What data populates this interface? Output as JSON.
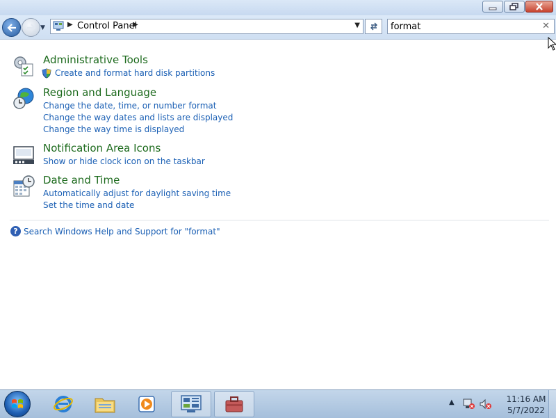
{
  "window": {
    "buttons": {
      "minimize": "minimize",
      "restore": "restore",
      "close": "close"
    }
  },
  "address": {
    "breadcrumb": "Control Panel",
    "dropdown_icon": "chevron-down-icon",
    "refresh_icon": "refresh-icon"
  },
  "search": {
    "value": "format",
    "clear_icon": "clear-icon"
  },
  "results": [
    {
      "title": "Administrative Tools",
      "icon": "administrative-tools-icon",
      "links": [
        "Create and format hard disk partitions"
      ]
    },
    {
      "title": "Region and Language",
      "icon": "globe-clock-icon",
      "links": [
        "Change the date, time, or number format",
        "Change the way dates and lists are displayed",
        "Change the way time is displayed"
      ]
    },
    {
      "title": "Notification Area Icons",
      "icon": "notification-area-icon",
      "links": [
        "Show or hide clock icon on the taskbar"
      ]
    },
    {
      "title": "Date and Time",
      "icon": "calendar-clock-icon",
      "links": [
        "Automatically adjust for daylight saving time",
        "Set the time and date"
      ]
    }
  ],
  "help": {
    "label": "Search Windows Help and Support for \"format\""
  },
  "taskbar": {
    "apps": [
      "start-orb",
      "internet-explorer",
      "windows-explorer",
      "media-player",
      "control-panel",
      "app"
    ],
    "active_app": "control-panel",
    "time": "11:16 AM",
    "date": "5/7/2022"
  },
  "colors": {
    "title_green": "#1e6b1e",
    "link_blue": "#1a5fb4"
  }
}
